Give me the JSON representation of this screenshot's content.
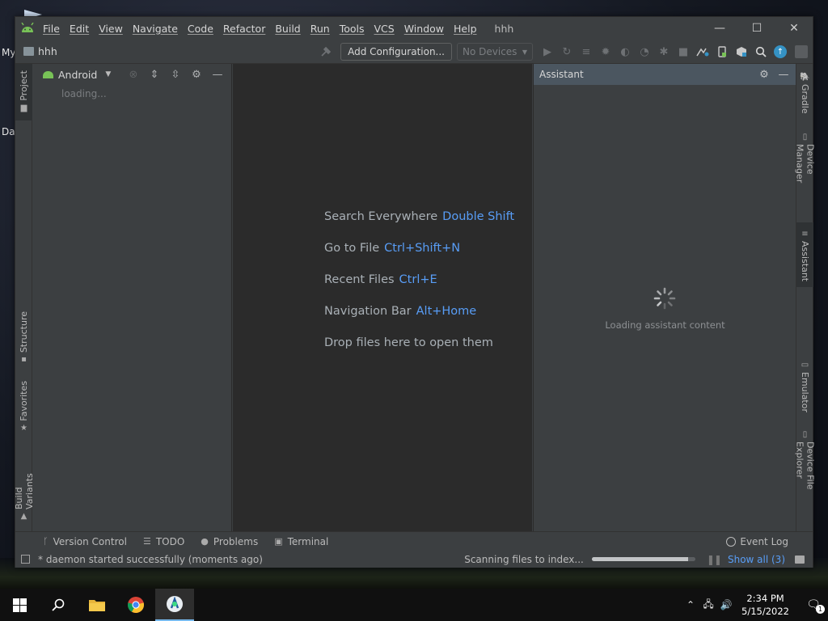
{
  "desktop": {
    "icon_label_1": "My",
    "icon_label_2": "Da"
  },
  "window": {
    "project_title": "hhh",
    "menu": [
      "File",
      "Edit",
      "View",
      "Navigate",
      "Code",
      "Refactor",
      "Build",
      "Run",
      "Tools",
      "VCS",
      "Window",
      "Help"
    ],
    "minimize_glyph": "—",
    "maximize_glyph": "☐",
    "close_glyph": "✕"
  },
  "navbar": {
    "breadcrumb": "hhh",
    "add_configuration": "Add Configuration...",
    "device_selector": "No Devices"
  },
  "left_stripe": {
    "project": "Project",
    "structure": "Structure",
    "favorites": "Favorites",
    "build_variants": "Build Variants"
  },
  "project_panel": {
    "view_selector": "Android",
    "status": "loading..."
  },
  "editor": {
    "hints": [
      {
        "label": "Search Everywhere",
        "shortcut": "Double Shift"
      },
      {
        "label": "Go to File",
        "shortcut": "Ctrl+Shift+N"
      },
      {
        "label": "Recent Files",
        "shortcut": "Ctrl+E"
      },
      {
        "label": "Navigation Bar",
        "shortcut": "Alt+Home"
      },
      {
        "label": "Drop files here to open them",
        "shortcut": ""
      }
    ]
  },
  "assistant": {
    "title": "Assistant",
    "loading": "Loading assistant content"
  },
  "right_stripe": {
    "gradle": "Gradle",
    "device_manager": "Device Manager",
    "assistant": "Assistant",
    "emulator": "Emulator",
    "device_file_explorer": "Device File Explorer"
  },
  "bottom_tools": {
    "version_control": "Version Control",
    "todo": "TODO",
    "problems": "Problems",
    "terminal": "Terminal",
    "event_log": "Event Log"
  },
  "statusbar": {
    "message": "* daemon started successfully (moments ago)",
    "scanning": "Scanning files to index...",
    "progress": 0.93,
    "show_all": "Show all (3)"
  },
  "taskbar": {
    "time": "2:34 PM",
    "date": "5/15/2022",
    "notification_count": "1"
  },
  "colors": {
    "accent_link": "#589df6",
    "android_green": "#78c257",
    "editor_bg": "#2b2b2b",
    "panel_bg": "#3c3f41"
  }
}
